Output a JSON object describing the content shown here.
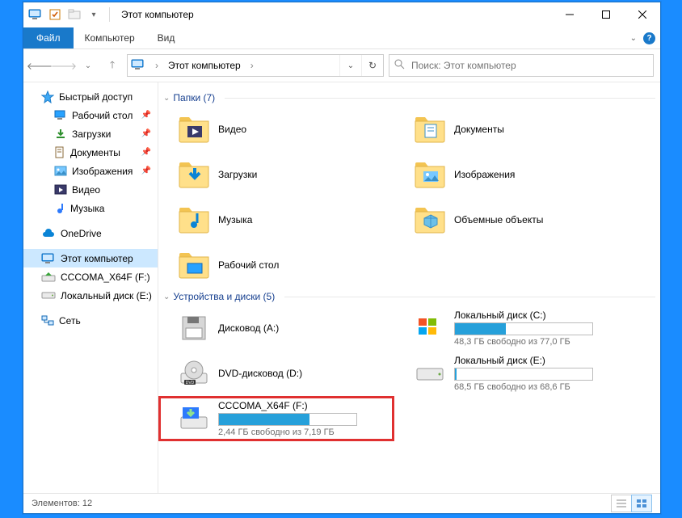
{
  "window": {
    "title": "Этот компьютер"
  },
  "ribbon": {
    "file": "Файл",
    "tabs": [
      "Компьютер",
      "Вид"
    ]
  },
  "nav": {
    "breadcrumb": "Этот компьютер",
    "search_placeholder": "Поиск: Этот компьютер"
  },
  "sidebar": {
    "quick": "Быстрый доступ",
    "quick_items": [
      {
        "label": "Рабочий стол",
        "icon": "desktop"
      },
      {
        "label": "Загрузки",
        "icon": "downloads"
      },
      {
        "label": "Документы",
        "icon": "documents"
      },
      {
        "label": "Изображения",
        "icon": "pictures"
      },
      {
        "label": "Видео",
        "icon": "videos"
      },
      {
        "label": "Музыка",
        "icon": "music"
      }
    ],
    "onedrive": "OneDrive",
    "this_pc": "Этот компьютер",
    "drive_cccoma": "CCCOMA_X64F (F:)",
    "drive_local_e": "Локальный диск (E:)",
    "network": "Сеть"
  },
  "groups": {
    "folders": {
      "title": "Папки (7)",
      "items": [
        {
          "label": "Видео",
          "icon": "videos"
        },
        {
          "label": "Документы",
          "icon": "documents"
        },
        {
          "label": "Загрузки",
          "icon": "downloads"
        },
        {
          "label": "Изображения",
          "icon": "pictures"
        },
        {
          "label": "Музыка",
          "icon": "music"
        },
        {
          "label": "Объемные объекты",
          "icon": "3d"
        },
        {
          "label": "Рабочий стол",
          "icon": "desktop"
        }
      ]
    },
    "drives": {
      "title": "Устройства и диски (5)",
      "items": [
        {
          "label": "Дисковод (A:)",
          "kind": "floppy"
        },
        {
          "label": "Локальный диск (C:)",
          "kind": "disk",
          "sub": "48,3 ГБ свободно из 77,0 ГБ",
          "fill": 37
        },
        {
          "label": "DVD-дисковод (D:)",
          "kind": "dvd"
        },
        {
          "label": "Локальный диск (E:)",
          "kind": "disk",
          "sub": "68,5 ГБ свободно из 68,6 ГБ",
          "fill": 1
        },
        {
          "label": "CCCOMA_X64F (F:)",
          "kind": "install",
          "sub": "2,44 ГБ свободно из 7,19 ГБ",
          "fill": 66,
          "highlight": true
        }
      ]
    }
  },
  "status": {
    "items": "Элементов: 12"
  }
}
